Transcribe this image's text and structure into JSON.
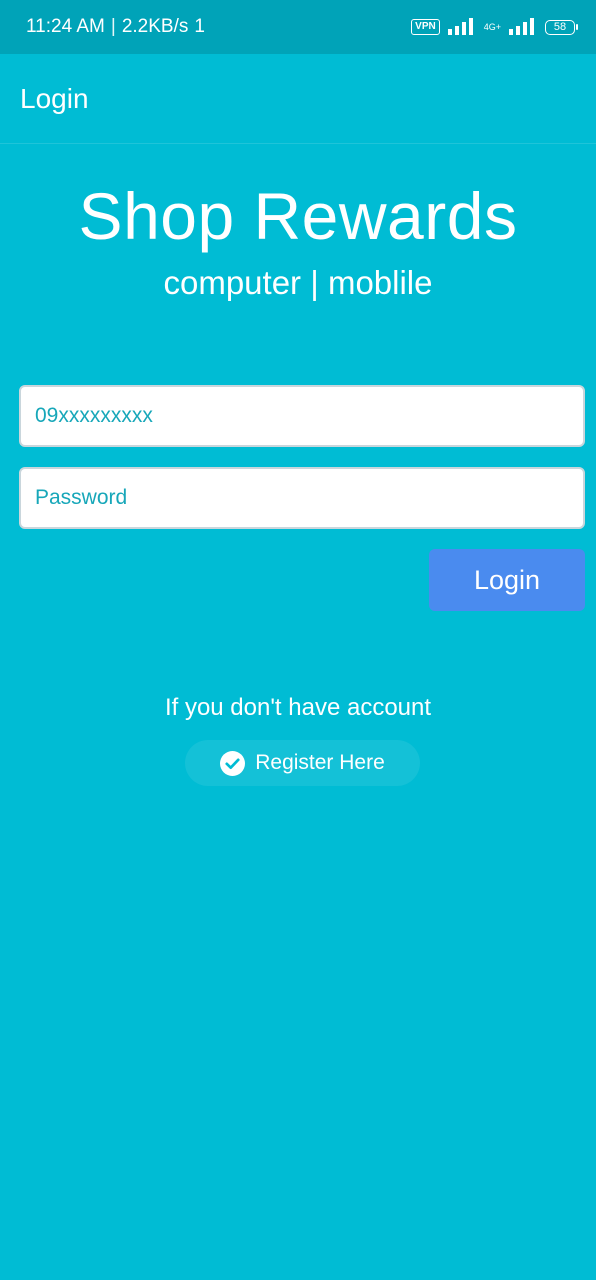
{
  "status_bar": {
    "time": "11:24 AM",
    "speed": "2.2KB/s",
    "sync": "1",
    "vpn_label": "VPN",
    "network_type": "4G+",
    "battery_level": "58"
  },
  "app_bar": {
    "title": "Login"
  },
  "brand": {
    "title": "Shop Rewards",
    "subtitle": "computer | moblile"
  },
  "form": {
    "phone_placeholder": "09xxxxxxxxx",
    "password_placeholder": "Password",
    "login_label": "Login"
  },
  "register": {
    "prompt": "If you don't have account",
    "button_label": "Register Here",
    "icon": "check-circle-icon"
  },
  "colors": {
    "background": "#00BCD4",
    "status_bar": "#00A3B8",
    "login_button": "#4A8BEF",
    "input_text": "#17A7B9"
  }
}
